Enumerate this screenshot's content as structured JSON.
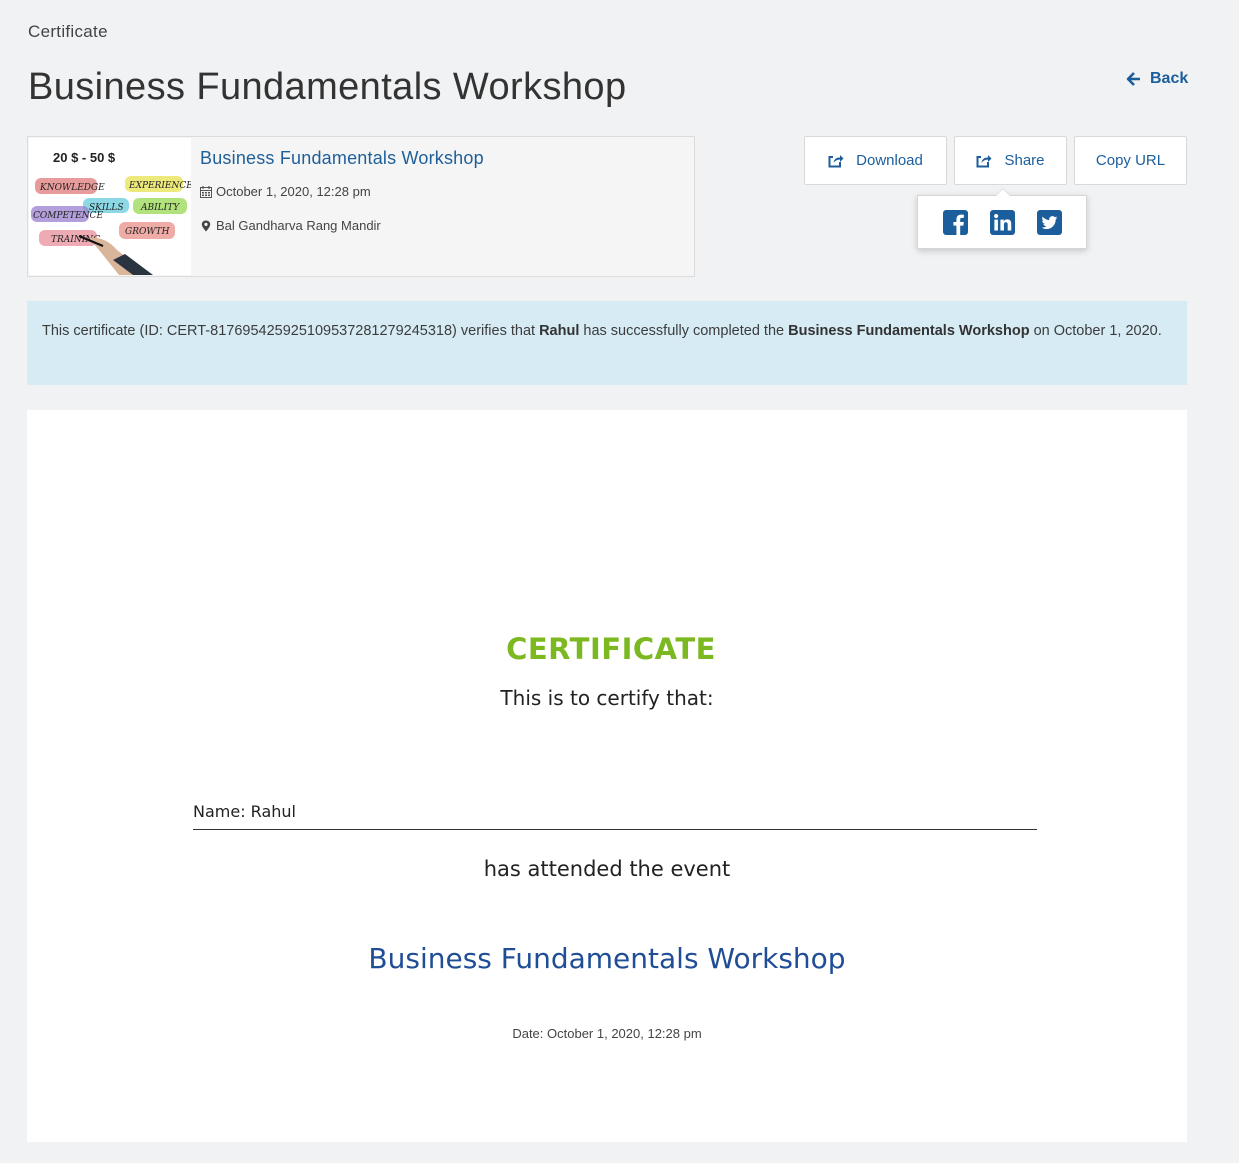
{
  "breadcrumb": "Certificate",
  "page_title": "Business Fundamentals Workshop",
  "back_label": "Back",
  "event": {
    "price": "20 $ - 50 $",
    "thumb_words": [
      "KNOWLEDGE",
      "EXPERIENCE",
      "SKILLS",
      "ABILITY",
      "COMPETENCE",
      "TRAINING",
      "GROWTH"
    ],
    "name": "Business Fundamentals Workshop",
    "date": "October 1, 2020, 12:28 pm",
    "venue": "Bal Gandharva Rang Mandir"
  },
  "actions": {
    "download": "Download",
    "share": "Share",
    "copy_url": "Copy URL"
  },
  "share_targets": [
    "facebook-icon",
    "linkedin-icon",
    "twitter-icon"
  ],
  "verification": {
    "prefix": "This certificate (ID: CERT-817695425925109537281279245318) verifies that ",
    "name": "Rahul",
    "middle": " has successfully completed the ",
    "event": "Business Fundamentals Workshop",
    "suffix": " on October 1, 2020."
  },
  "certificate": {
    "heading": "CERTIFICATE",
    "certify_text": "This is to certify that:",
    "name_line": "Name: Rahul",
    "attended_text": "has attended the event",
    "event_name": "Business Fundamentals Workshop",
    "date_line": "Date: October 1, 2020, 12:28 pm"
  },
  "colors": {
    "link": "#1b5e9b",
    "heading_green": "#7cb81f",
    "event_blue": "#1f4e96",
    "info_bg": "#d6ebf4",
    "page_bg": "#f1f2f3"
  }
}
